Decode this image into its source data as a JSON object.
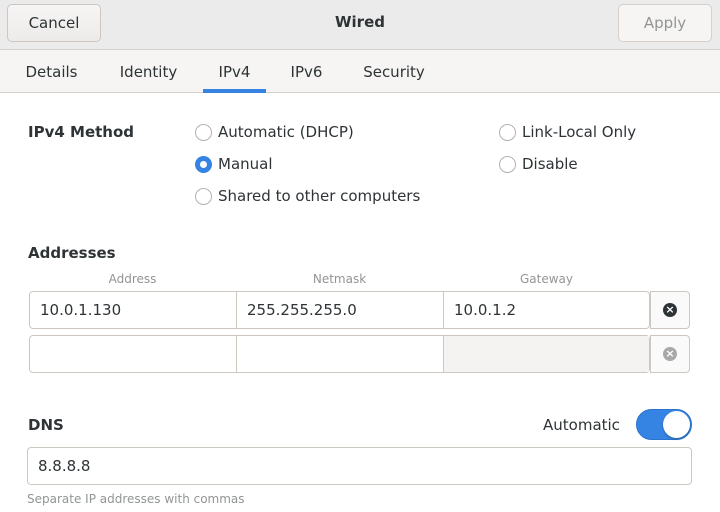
{
  "header": {
    "title": "Wired",
    "cancel_label": "Cancel",
    "apply_label": "Apply"
  },
  "tabs": [
    {
      "label": "Details",
      "active": false
    },
    {
      "label": "Identity",
      "active": false
    },
    {
      "label": "IPv4",
      "active": true
    },
    {
      "label": "IPv6",
      "active": false
    },
    {
      "label": "Security",
      "active": false
    }
  ],
  "ipv4_method": {
    "label": "IPv4 Method",
    "options": {
      "automatic": {
        "label": "Automatic (DHCP)",
        "checked": false
      },
      "manual": {
        "label": "Manual",
        "checked": true
      },
      "shared": {
        "label": "Shared to other computers",
        "checked": false
      },
      "link_local": {
        "label": "Link-Local Only",
        "checked": false
      },
      "disable": {
        "label": "Disable",
        "checked": false
      }
    }
  },
  "addresses": {
    "label": "Addresses",
    "columns": [
      "Address",
      "Netmask",
      "Gateway"
    ],
    "rows": [
      {
        "address": "10.0.1.130",
        "netmask": "255.255.255.0",
        "gateway": "10.0.1.2"
      },
      {
        "address": "",
        "netmask": "",
        "gateway": ""
      }
    ]
  },
  "dns": {
    "label": "DNS",
    "automatic_label": "Automatic",
    "automatic_on": true,
    "value": "8.8.8.8",
    "hint": "Separate IP addresses with commas"
  },
  "colors": {
    "accent": "#3584e4"
  }
}
